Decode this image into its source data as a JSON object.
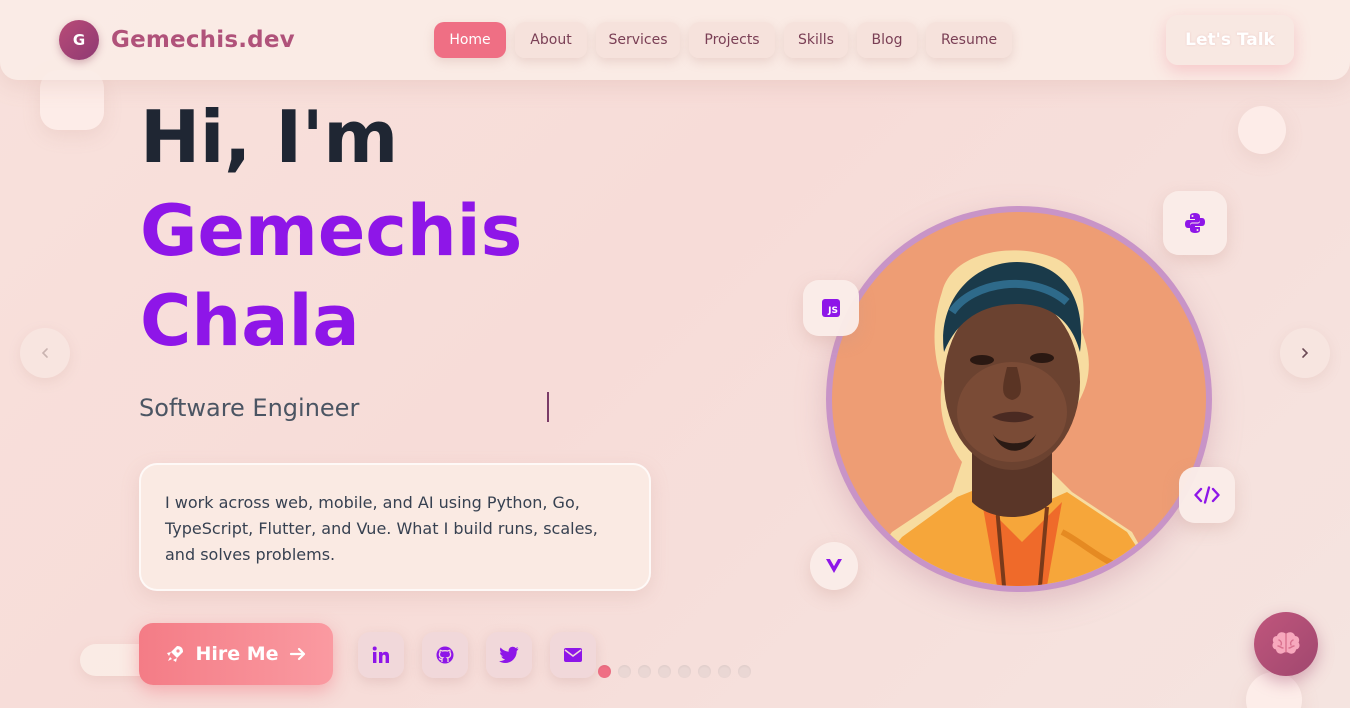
{
  "header": {
    "logo_initial": "G",
    "logo_text": "Gemechis.dev",
    "nav": [
      {
        "label": "Home",
        "active": true
      },
      {
        "label": "About",
        "active": false
      },
      {
        "label": "Services",
        "active": false
      },
      {
        "label": "Projects",
        "active": false
      },
      {
        "label": "Skills",
        "active": false
      },
      {
        "label": "Blog",
        "active": false
      },
      {
        "label": "Resume",
        "active": false
      }
    ],
    "cta_label": "Let's Talk"
  },
  "hero": {
    "greeting": "Hi, I'm",
    "first_name": "Gemechis",
    "last_name": "Chala",
    "role": "Software Engineer",
    "intro": "I work across web, mobile, and AI using Python, Go, TypeScript, Flutter, and Vue. What I build runs, scales, and solves problems.",
    "hire_label": "Hire Me"
  },
  "social": [
    {
      "icon": "linkedin-icon"
    },
    {
      "icon": "github-icon"
    },
    {
      "icon": "twitter-icon"
    },
    {
      "icon": "mail-icon"
    }
  ],
  "carousel": {
    "count": 8,
    "active_index": 0
  },
  "badges": {
    "js": "JS",
    "python_icon": "python-icon",
    "code_icon": "code-icon",
    "vue_icon": "vue-icon"
  },
  "colors": {
    "accent": "#ef6f84",
    "name": "#8e16e8",
    "logo": "#b0527a",
    "avatar_bg": "#ee9d74"
  }
}
